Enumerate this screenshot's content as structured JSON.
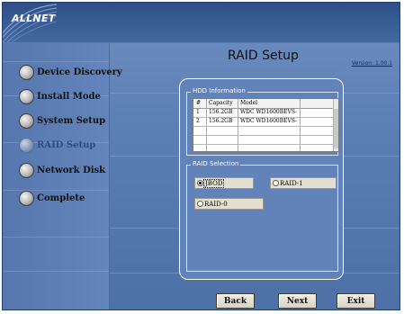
{
  "brand": {
    "logo_text": "ALLNET"
  },
  "page": {
    "title": "RAID Setup",
    "version": "Version: 1.00.1"
  },
  "sidebar": {
    "items": [
      {
        "label": "Device Discovery",
        "active": false
      },
      {
        "label": "Install Mode",
        "active": false
      },
      {
        "label": "System Setup",
        "active": false
      },
      {
        "label": "RAID Setup",
        "active": true
      },
      {
        "label": "Network Disk",
        "active": false
      },
      {
        "label": "Complete",
        "active": false
      }
    ]
  },
  "hdd": {
    "title": "HDD Information",
    "columns": [
      "#",
      "Capacity",
      "Model"
    ],
    "rows": [
      {
        "num": "1",
        "capacity": "156.2GB",
        "model": "WDC WD1600BEVS-"
      },
      {
        "num": "2",
        "capacity": "156.2GB",
        "model": "WDC WD1600BEVS-"
      }
    ]
  },
  "raid": {
    "title": "RAID Selection",
    "options": [
      {
        "label": "JBOD",
        "selected": true
      },
      {
        "label": "RAID-1",
        "selected": false
      },
      {
        "label": "RAID-0",
        "selected": false
      }
    ]
  },
  "buttons": {
    "back": "Back",
    "next": "Next",
    "exit": "Exit"
  },
  "colors": {
    "background": "#5a7db3",
    "panel": "#6183ba",
    "header": "#2d4f86",
    "active_nav": "#2a4c85"
  },
  "icons": {
    "nav_bullet": "radio-bullet-icon",
    "logo": "swirl-logo-icon"
  }
}
